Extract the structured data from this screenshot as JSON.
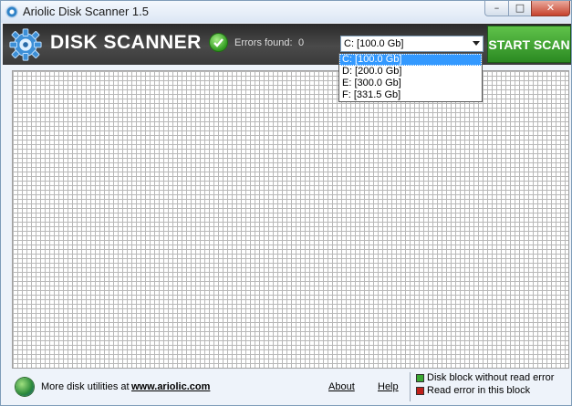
{
  "window": {
    "title": "Ariolic Disk Scanner 1.5"
  },
  "window_controls": {
    "min": "–",
    "max": "□",
    "close": "✕"
  },
  "header": {
    "logo_text": "DISK SCANNER",
    "errors_label": "Errors found:",
    "errors_count": "0",
    "drive_selected": "C:  [100.0 Gb]",
    "drive_options": [
      "C:  [100.0 Gb]",
      "D:  [200.0 Gb]",
      "E:  [300.0 Gb]",
      "F:  [331.5 Gb]"
    ],
    "start_button": "START SCAN"
  },
  "footer": {
    "more_text": "More disk utilities at",
    "link_text": "www.ariolic.com",
    "about": "About",
    "help": "Help",
    "legend_ok": "Disk block without read error",
    "legend_err": "Read error in this block"
  },
  "colors": {
    "ok": "#3aa832",
    "error": "#c0201a",
    "start": "#3a9a2a"
  }
}
